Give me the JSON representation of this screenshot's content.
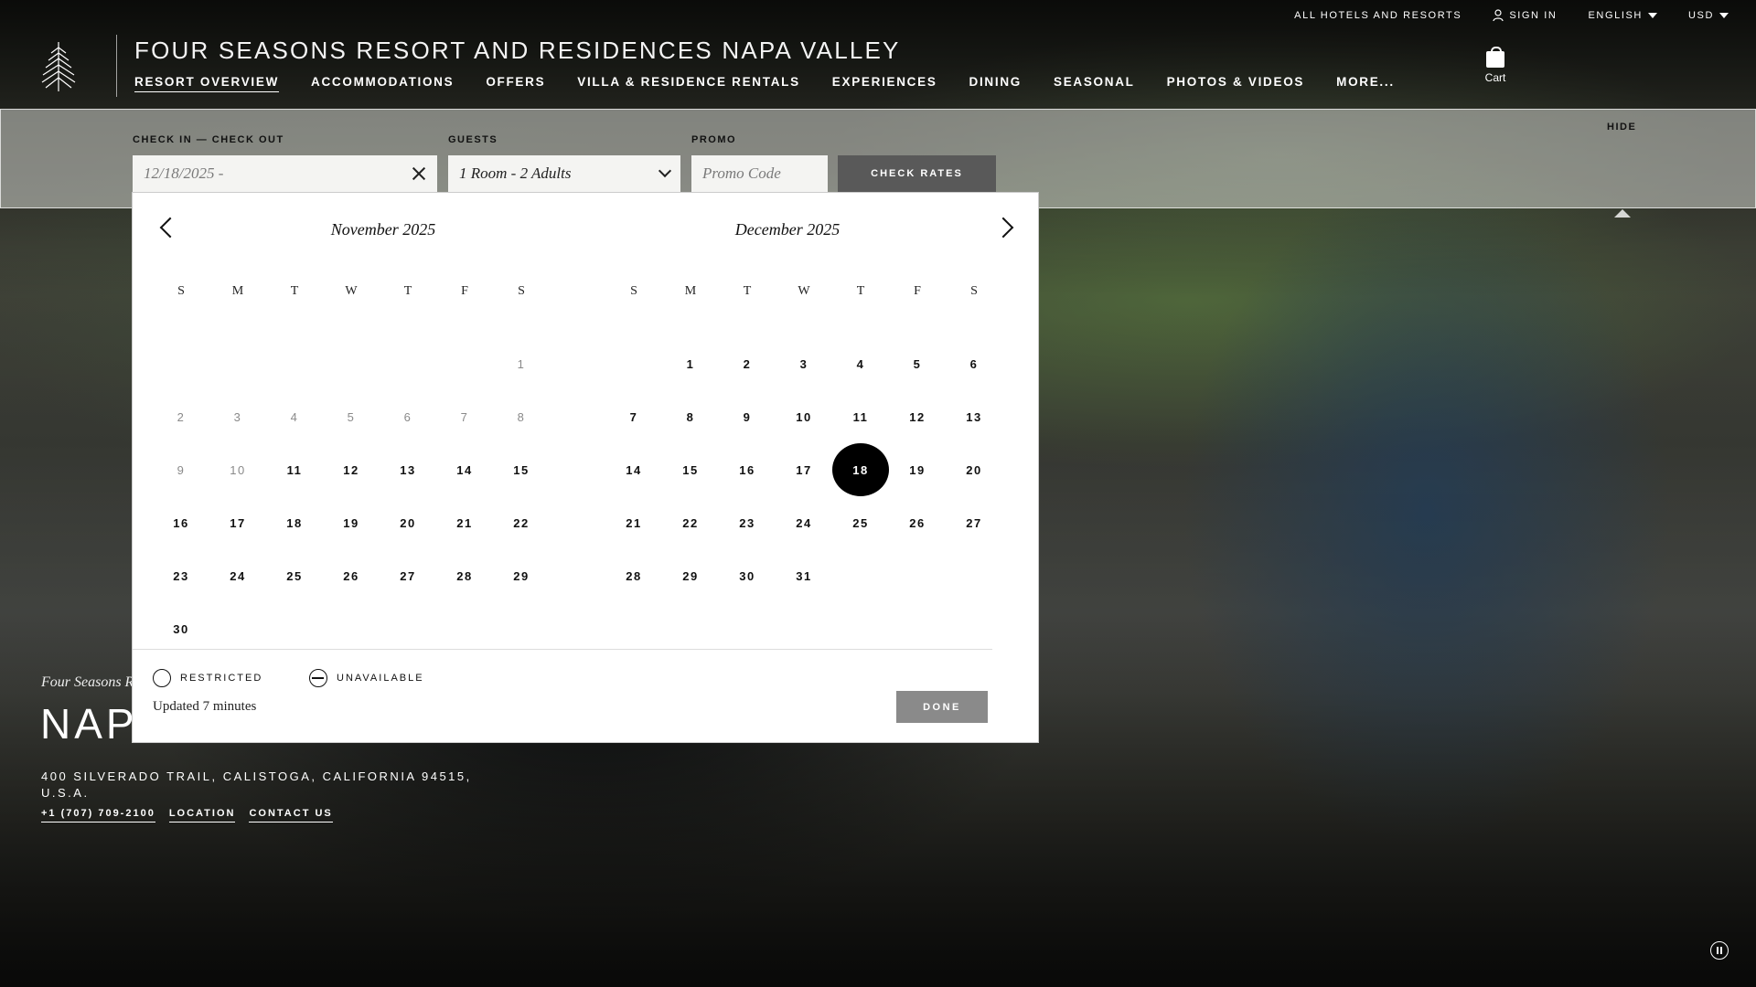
{
  "utility": {
    "all_hotels": "ALL HOTELS AND RESORTS",
    "sign_in": "SIGN IN",
    "language": "ENGLISH",
    "currency": "USD"
  },
  "header": {
    "hotel_name": "FOUR SEASONS RESORT AND RESIDENCES NAPA VALLEY",
    "nav": [
      "RESORT OVERVIEW",
      "ACCOMMODATIONS",
      "OFFERS",
      "VILLA & RESIDENCE RENTALS",
      "EXPERIENCES",
      "DINING",
      "SEASONAL",
      "PHOTOS & VIDEOS",
      "MORE..."
    ],
    "cart_label": "Cart"
  },
  "booking": {
    "dates_label": "CHECK IN — CHECK OUT",
    "dates_value": "12/18/2025 -",
    "guests_label": "GUESTS",
    "guests_value": "1 Room - 2 Adults",
    "promo_label": "PROMO",
    "promo_placeholder": "Promo Code",
    "check_rates": "CHECK RATES",
    "hide": "HIDE"
  },
  "calendar": {
    "left_month": "November 2025",
    "right_month": "December 2025",
    "weekdays": [
      "S",
      "M",
      "T",
      "W",
      "T",
      "F",
      "S"
    ],
    "november": {
      "offset": 6,
      "days": [
        "1",
        "2",
        "3",
        "4",
        "5",
        "6",
        "7",
        "8",
        "9",
        "10",
        "11",
        "12",
        "13",
        "14",
        "15",
        "16",
        "17",
        "18",
        "19",
        "20",
        "21",
        "22",
        "23",
        "24",
        "25",
        "26",
        "27",
        "28",
        "29",
        "30"
      ],
      "past_through": 10
    },
    "december": {
      "offset": 1,
      "days": [
        "1",
        "2",
        "3",
        "4",
        "5",
        "6",
        "7",
        "8",
        "9",
        "10",
        "11",
        "12",
        "13",
        "14",
        "15",
        "16",
        "17",
        "18",
        "19",
        "20",
        "21",
        "22",
        "23",
        "24",
        "25",
        "26",
        "27",
        "28",
        "29",
        "30",
        "31"
      ],
      "selected": "18"
    },
    "legend_restricted": "RESTRICTED",
    "legend_unavailable": "UNAVAILABLE",
    "updated": "Updated 7 minutes",
    "done": "DONE"
  },
  "hotel_info": {
    "subtitle": "Four Seasons R",
    "big_title": "NAP",
    "address": "400 SILVERADO TRAIL, CALISTOGA, CALIFORNIA 94515, U.S.A.",
    "phone": "+1 (707) 709-2100",
    "location": "LOCATION",
    "contact": "CONTACT US"
  }
}
